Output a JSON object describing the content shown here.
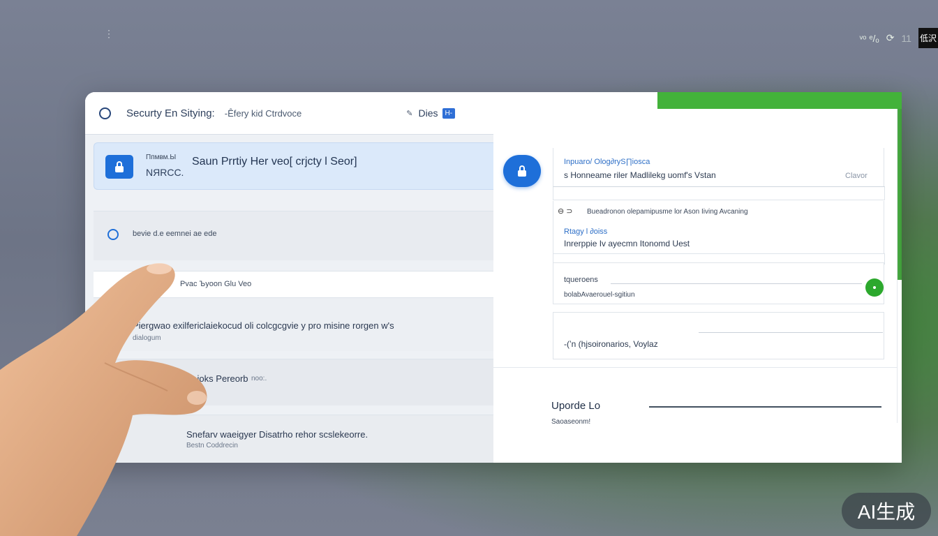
{
  "header": {
    "title": "Securty En Sitying:",
    "subtitle": "-Êfery kid Ctrdvoce",
    "doc_label": "Dies",
    "doc_tag": "H-"
  },
  "topbar": {
    "icons_text": "ᵛᵒ ᵉ/ₒ",
    "count": "11",
    "badge": "低沢"
  },
  "selected": {
    "meta_top": "Ппмвм.Ы",
    "meta_bottom": "NЯRCC.",
    "title": "Saun Prrtiy Her veo[ crjcty l Seor]"
  },
  "list": [
    {
      "text": "bevie d.e eemnei ae ede"
    },
    {
      "text": "Pvac Ъyoon Glu Veo"
    },
    {
      "text": "Piergwao exilfericlaiekocud oli colcgcgvie y pro misine rorgen w's",
      "sub": "dialogum"
    },
    {
      "text": "Rvico do Bnet ioks Pereorb",
      "suffix": "noo:.",
      "sub": "Commeon"
    },
    {
      "text": "Snefarv waeigyer Disatrho rehor scslekeorre.",
      "sub": "Bestn Coddrecin"
    }
  ],
  "panel": {
    "field1_label": "Inpuaro/ Olog∂ryS∏iosca",
    "field1_value": "s Honneame riler Madlilekg uomf's Vstan",
    "field1_hint": "Clavor",
    "info_line": "Bueadronon olepamipusme lor Ason Iiving Avcaning",
    "field2_label": "Rtagy l ∂oiss",
    "field2_value": "Inrerppie Iv ayecmn Itonomd Uest",
    "field3_label": "tqueroens",
    "field3_value": "bolabAvaerouel-sgitiun",
    "field4_value": "-(ʼn (hjsoironarios, Voylaz",
    "update_title": "Uporde Lo",
    "update_sub": "Saoaseonm!"
  },
  "watermark": "AI生成",
  "colors": {
    "accent_blue": "#1e6fd9",
    "accent_green": "#43b23a"
  }
}
